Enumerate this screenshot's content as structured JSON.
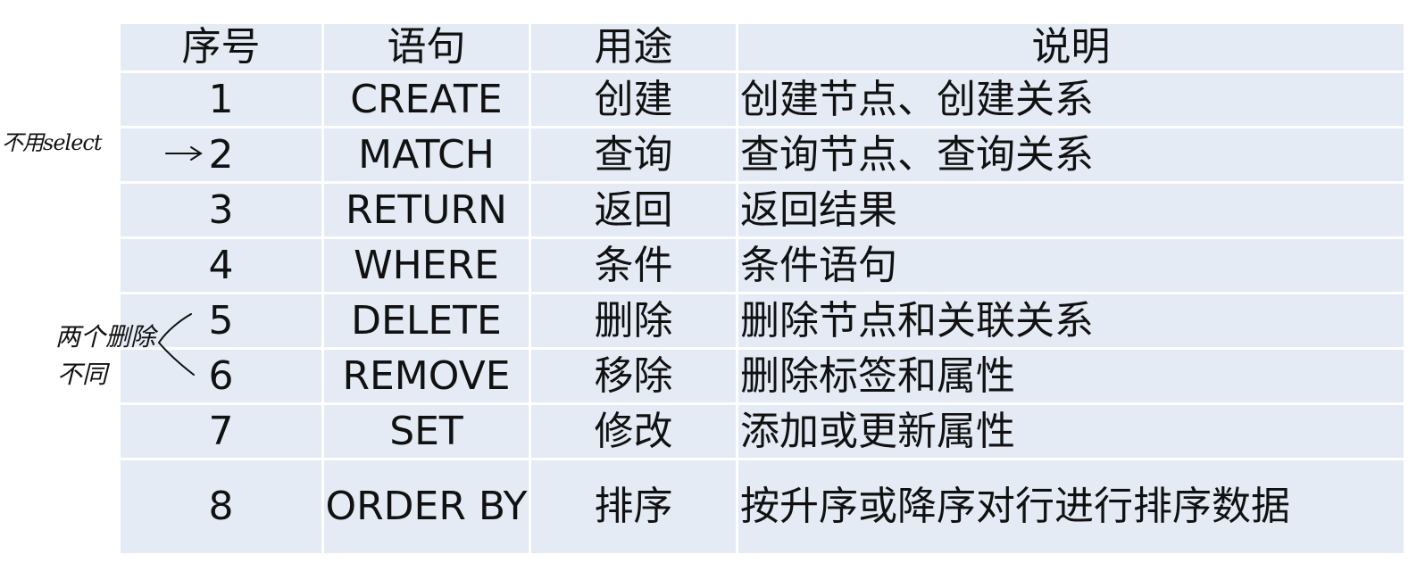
{
  "table": {
    "headers": [
      "序号",
      "语句",
      "用途",
      "说明"
    ],
    "rows": [
      {
        "no": "1",
        "statement": "CREATE",
        "usage": "创建",
        "description": "创建节点、创建关系"
      },
      {
        "no": "2",
        "statement": "MATCH",
        "usage": "查询",
        "description": "查询节点、查询关系"
      },
      {
        "no": "3",
        "statement": "RETURN",
        "usage": "返回",
        "description": "返回结果"
      },
      {
        "no": "4",
        "statement": "WHERE",
        "usage": "条件",
        "description": "条件语句"
      },
      {
        "no": "5",
        "statement": "DELETE",
        "usage": "删除",
        "description": "删除节点和关联关系"
      },
      {
        "no": "6",
        "statement": "REMOVE",
        "usage": "移除",
        "description": "删除标签和属性"
      },
      {
        "no": "7",
        "statement": "SET",
        "usage": "修改",
        "description": "添加或更新属性"
      },
      {
        "no": "8",
        "statement": "ORDER BY",
        "usage": "排序",
        "description": "按升序或降序对行进行排序数据"
      }
    ]
  },
  "annotations": {
    "select_note": "不用select",
    "delete_note_line1": "两个删除",
    "delete_note_line2": "不同"
  }
}
